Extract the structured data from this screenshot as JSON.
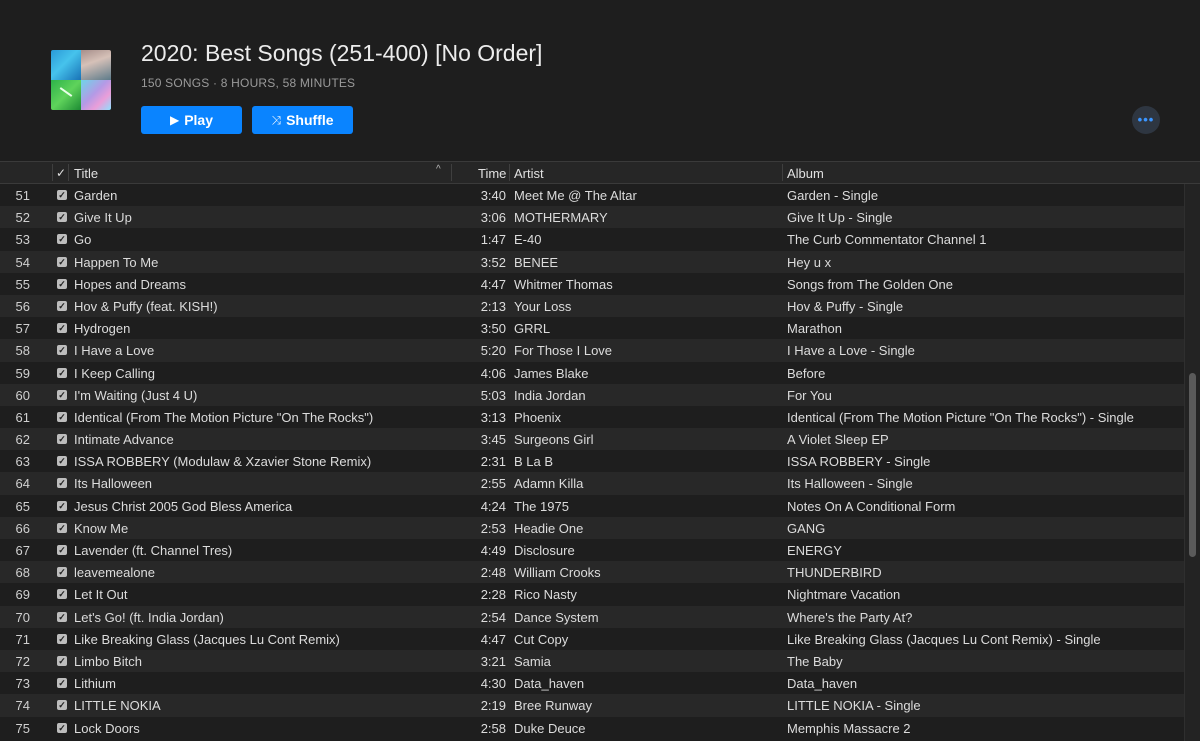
{
  "playlist": {
    "title": "2020: Best Songs (251-400) [No Order]",
    "subtitle": "150 SONGS · 8 HOURS, 58 MINUTES",
    "play_label": "Play",
    "shuffle_label": "Shuffle",
    "more_label": "•••",
    "play_icon": "▶",
    "shuffle_icon": "⤨"
  },
  "columns": {
    "check": "✓",
    "title": "Title",
    "sort_indicator": "^",
    "time": "Time",
    "artist": "Artist",
    "album": "Album"
  },
  "colors": {
    "accent": "#0a84ff",
    "background": "#1e1e1e",
    "row_alt": "#282828"
  },
  "scroll": {
    "position_fraction": 0.34,
    "visible_fraction": 0.33
  },
  "tracks": [
    {
      "num": "51",
      "title": "Garden",
      "time": "3:40",
      "artist": "Meet Me @ The Altar",
      "album": "Garden - Single"
    },
    {
      "num": "52",
      "title": "Give It Up",
      "time": "3:06",
      "artist": "MOTHERMARY",
      "album": "Give It Up - Single"
    },
    {
      "num": "53",
      "title": "Go",
      "time": "1:47",
      "artist": "E-40",
      "album": "The Curb Commentator Channel 1"
    },
    {
      "num": "54",
      "title": "Happen To Me",
      "time": "3:52",
      "artist": "BENEE",
      "album": "Hey u x"
    },
    {
      "num": "55",
      "title": "Hopes and Dreams",
      "time": "4:47",
      "artist": "Whitmer Thomas",
      "album": "Songs from The Golden One"
    },
    {
      "num": "56",
      "title": "Hov & Puffy (feat. KISH!)",
      "time": "2:13",
      "artist": "Your Loss",
      "album": "Hov & Puffy - Single"
    },
    {
      "num": "57",
      "title": "Hydrogen",
      "time": "3:50",
      "artist": "GRRL",
      "album": "Marathon"
    },
    {
      "num": "58",
      "title": "I Have a Love",
      "time": "5:20",
      "artist": "For Those I Love",
      "album": "I Have a Love - Single"
    },
    {
      "num": "59",
      "title": "I Keep Calling",
      "time": "4:06",
      "artist": "James Blake",
      "album": "Before"
    },
    {
      "num": "60",
      "title": "I'm Waiting (Just 4 U)",
      "time": "5:03",
      "artist": "India Jordan",
      "album": "For You"
    },
    {
      "num": "61",
      "title": "Identical (From The Motion Picture \"On The Rocks\")",
      "time": "3:13",
      "artist": "Phoenix",
      "album": "Identical (From The Motion Picture \"On The Rocks\") - Single"
    },
    {
      "num": "62",
      "title": "Intimate Advance",
      "time": "3:45",
      "artist": "Surgeons Girl",
      "album": "A Violet Sleep EP"
    },
    {
      "num": "63",
      "title": "ISSA ROBBERY (Modulaw & Xzavier Stone Remix)",
      "time": "2:31",
      "artist": "B La B",
      "album": "ISSA ROBBERY - Single"
    },
    {
      "num": "64",
      "title": "Its Halloween",
      "time": "2:55",
      "artist": "Adamn Killa",
      "album": "Its Halloween - Single"
    },
    {
      "num": "65",
      "title": "Jesus Christ 2005 God Bless America",
      "time": "4:24",
      "artist": "The 1975",
      "album": "Notes On A Conditional Form"
    },
    {
      "num": "66",
      "title": "Know Me",
      "time": "2:53",
      "artist": "Headie One",
      "album": "GANG"
    },
    {
      "num": "67",
      "title": "Lavender (ft. Channel Tres)",
      "time": "4:49",
      "artist": "Disclosure",
      "album": "ENERGY"
    },
    {
      "num": "68",
      "title": "leavemealone",
      "time": "2:48",
      "artist": "William Crooks",
      "album": "THUNDERBIRD"
    },
    {
      "num": "69",
      "title": "Let It Out",
      "time": "2:28",
      "artist": "Rico Nasty",
      "album": "Nightmare Vacation"
    },
    {
      "num": "70",
      "title": "Let's Go! (ft. India Jordan)",
      "time": "2:54",
      "artist": "Dance System",
      "album": "Where's the Party At?"
    },
    {
      "num": "71",
      "title": "Like Breaking Glass (Jacques Lu Cont Remix)",
      "time": "4:47",
      "artist": "Cut Copy",
      "album": "Like Breaking Glass (Jacques Lu Cont Remix) - Single"
    },
    {
      "num": "72",
      "title": "Limbo Bitch",
      "time": "3:21",
      "artist": "Samia",
      "album": "The Baby"
    },
    {
      "num": "73",
      "title": "Lithium",
      "time": "4:30",
      "artist": "Data_haven",
      "album": "Data_haven"
    },
    {
      "num": "74",
      "title": "LITTLE NOKIA",
      "time": "2:19",
      "artist": "Bree Runway",
      "album": "LITTLE NOKIA - Single"
    },
    {
      "num": "75",
      "title": "Lock Doors",
      "time": "2:58",
      "artist": "Duke Deuce",
      "album": "Memphis Massacre 2"
    }
  ]
}
